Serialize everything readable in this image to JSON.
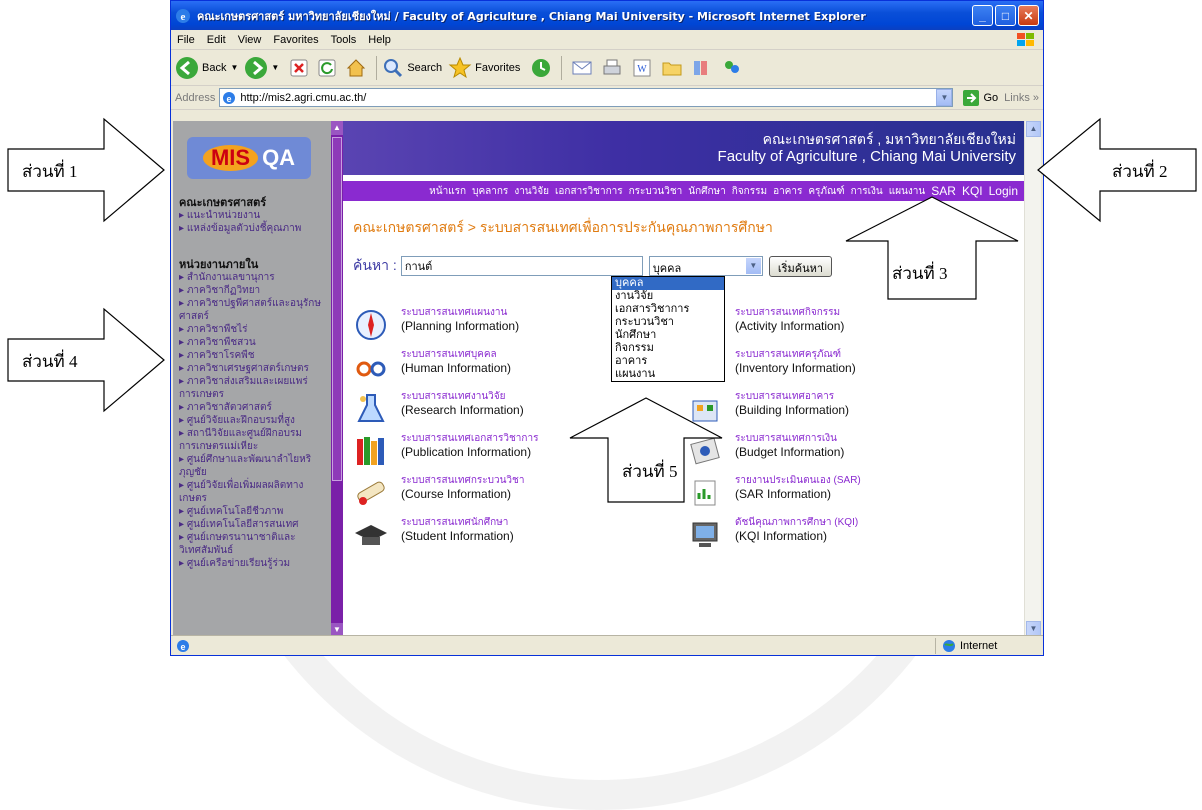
{
  "window": {
    "title": "คณะเกษตรศาสตร์ มหาวิทยาลัยเชียงใหม่ / Faculty of Agriculture , Chiang Mai University - Microsoft Internet Explorer",
    "minimize_label": "_",
    "maximize_label": "□",
    "close_label": "✕"
  },
  "menubar": [
    "File",
    "Edit",
    "View",
    "Favorites",
    "Tools",
    "Help"
  ],
  "toolbar": {
    "back_label": "Back",
    "search_label": "Search",
    "favorites_label": "Favorites"
  },
  "address": {
    "label": "Address",
    "url": "http://mis2.agri.cmu.ac.th/",
    "go_label": "Go",
    "links_label": "Links »"
  },
  "sidebar": {
    "logo_mis": "MIS",
    "logo_qa": "QA",
    "heading_faculty": "คณะเกษตรศาสตร์",
    "faculty_items": [
      "แนะนำหน่วยงาน",
      "แหล่งข้อมูลตัวบ่งชี้คุณภาพ"
    ],
    "heading_units": "หน่วยงานภายใน",
    "unit_items": [
      "สำนักงานเลขานุการ",
      "ภาควิชากีฏวิทยา",
      "ภาควิชาปฐพีศาสตร์และอนุรักษศาสตร์",
      "ภาควิชาพืชไร่",
      "ภาควิชาพืชสวน",
      "ภาควิชาโรคพืช",
      "ภาควิชาเศรษฐศาสตร์เกษตร",
      "ภาควิชาส่งเสริมและเผยแพร่การเกษตร",
      "ภาควิชาสัตวศาสตร์",
      "ศูนย์วิจัยและฝึกอบรมที่สูง",
      "สถานีวิจัยและศูนย์ฝึกอบรมการเกษตรแม่เหียะ",
      "ศูนย์ศึกษาและพัฒนาลำไยหริภุญชัย",
      "ศูนย์วิจัยเพื่อเพิ่มผลผลิตทางเกษตร",
      "ศูนย์เทคโนโลยีชีวภาพ",
      "ศูนย์เทคโนโลยีสารสนเทศ",
      "ศูนย์เกษตรนานาชาติและวิเทศสัมพันธ์",
      "ศูนย์เครือข่ายเรียนรู้ร่วม"
    ]
  },
  "header": {
    "thai": "คณะเกษตรศาสตร์ , มหาวิทยาลัยเชียงใหม่",
    "english": "Faculty of Agriculture , Chiang Mai University"
  },
  "nav": [
    "หน้าแรก",
    "บุคลากร",
    "งานวิจัย",
    "เอกสารวิชาการ",
    "กระบวนวิชา",
    "นักศึกษา",
    "กิจกรรม",
    "อาคาร",
    "ครุภัณฑ์",
    "การเงิน",
    "แผนงาน",
    "SAR",
    "KQI",
    "Login"
  ],
  "breadcrumb": "คณะเกษตรศาสตร์ > ระบบสารสนเทศเพื่อการประกันคุณภาพการศึกษา",
  "search": {
    "label": "ค้นหา :",
    "value": "กานต์",
    "select_value": "บุคคล",
    "button_label": "เริ่มค้นหา",
    "options": [
      "บุคคล",
      "งานวิจัย",
      "เอกสารวิชาการ",
      "กระบวนวิชา",
      "นักศึกษา",
      "กิจกรรม",
      "อาคาร",
      "แผนงาน"
    ]
  },
  "cards_left": [
    {
      "icon": "compass-icon",
      "thai": "ระบบสารสนเทศแผนงาน",
      "english": "(Planning Information)"
    },
    {
      "icon": "glasses-icon",
      "thai": "ระบบสารสนเทศบุคคล",
      "english": "(Human Information)"
    },
    {
      "icon": "lab-flask-icon",
      "thai": "ระบบสารสนเทศงานวิจัย",
      "english": "(Research Information)"
    },
    {
      "icon": "books-icon",
      "thai": "ระบบสารสนเทศเอกสารวิชาการ",
      "english": "(Publication Information)"
    },
    {
      "icon": "diploma-icon",
      "thai": "ระบบสารสนเทศกระบวนวิชา",
      "english": "(Course Information)"
    },
    {
      "icon": "graduation-cap-icon",
      "thai": "ระบบสารสนเทศนักศึกษา",
      "english": "(Student Information)"
    }
  ],
  "cards_right": [
    {
      "icon": "activity-icon",
      "thai": "ระบบสารสนเทศกิจกรรม",
      "english": "(Activity Information)"
    },
    {
      "icon": "inventory-icon",
      "thai": "ระบบสารสนเทศครุภัณฑ์",
      "english": "(Inventory Information)"
    },
    {
      "icon": "building-icon",
      "thai": "ระบบสารสนเทศอาคาร",
      "english": "(Building Information)"
    },
    {
      "icon": "budget-icon",
      "thai": "ระบบสารสนเทศการเงิน",
      "english": "(Budget Information)"
    },
    {
      "icon": "report-icon",
      "thai": "รายงานประเมินตนเอง (SAR)",
      "english": "(SAR Information)"
    },
    {
      "icon": "computer-icon",
      "thai": "ดัชนีคุณภาพการศึกษา (KQI)",
      "english": "(KQI Information)"
    }
  ],
  "status": {
    "zone": "Internet"
  },
  "annotations": [
    "ส่วนที่ 1",
    "ส่วนที่ 2",
    "ส่วนที่ 3",
    "ส่วนที่ 4",
    "ส่วนที่ 5"
  ]
}
